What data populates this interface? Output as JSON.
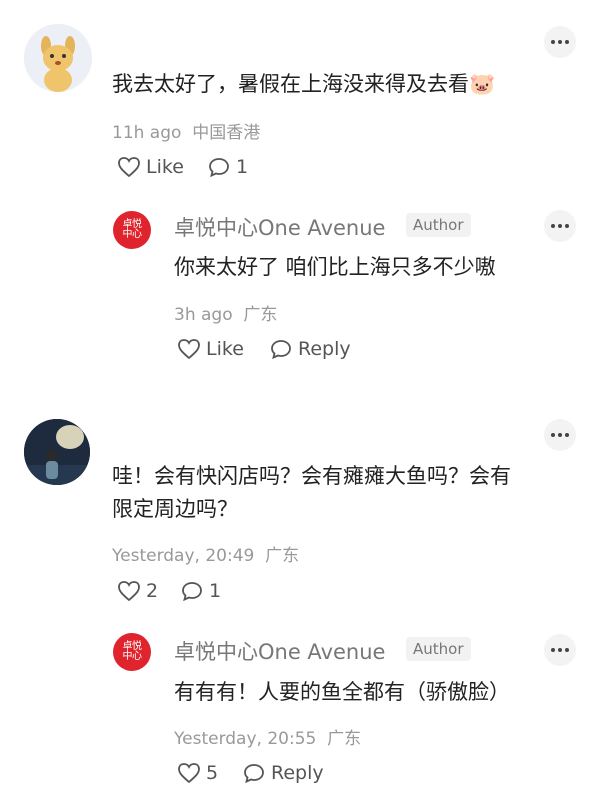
{
  "comments": [
    {
      "text": "我去太好了，暑假在上海没来得及去看",
      "emoji": "🐷",
      "time": "11h ago",
      "location": "中国香港",
      "like_label": "Like",
      "comment_count": "1",
      "reply": {
        "author": "卓悦中心One Avenue",
        "badge": "Author",
        "text": "你来太好了 咱们比上海只多不少嗷",
        "time": "3h ago",
        "location": "广东",
        "like_label": "Like",
        "reply_label": "Reply"
      }
    },
    {
      "text_line1": "哇！会有快闪店吗？会有瘫瘫大鱼吗？会有",
      "text_line2": "限定周边吗？",
      "time": "Yesterday, 20:49",
      "location": "广东",
      "like_count": "2",
      "comment_count": "1",
      "reply": {
        "author": "卓悦中心One Avenue",
        "badge": "Author",
        "text": "有有有！人要的鱼全都有（骄傲脸）",
        "time": "Yesterday, 20:55",
        "location": "广东",
        "like_count": "5",
        "reply_label": "Reply"
      }
    }
  ],
  "brand_logo": {
    "main": "卓悦",
    "main2": "中心",
    "sub": "ONE AVENUE"
  },
  "colors": {
    "brand_red": "#e0242d",
    "meta_gray": "#999999"
  }
}
